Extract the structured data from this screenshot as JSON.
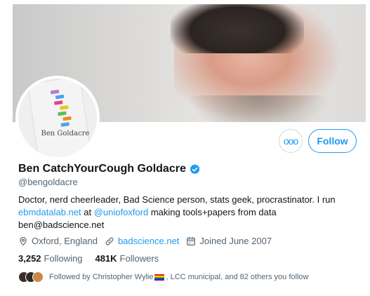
{
  "profile": {
    "name": "Ben CatchYourCough Goldacre",
    "handle": "@bengoldacre",
    "avatar_book_title": "Ben Goldacre",
    "bio": {
      "line1": "Doctor, nerd cheerleader, Bad Science person, stats geek, procrastinator. I run",
      "link1": "ebmdatalab.net",
      "at": " at ",
      "link2": "@uniofoxford",
      "line2_rest": " making tools+papers from data",
      "line3": "ben@badscience.net"
    },
    "location": "Oxford, England",
    "website": "badscience.net",
    "joined": "Joined June 2007",
    "following_count": "3,252",
    "following_label": "Following",
    "followers_count": "481K",
    "followers_label": "Followers",
    "followed_by_prefix": "Followed by Christopher Wylie",
    "followed_by_rest": ", LCC municipal, and 82 others you follow"
  },
  "actions": {
    "more_label": "ooo",
    "follow_label": "Follow"
  },
  "colors": {
    "accent": "#1d9bf0",
    "text": "#0f1419",
    "muted": "#536471"
  },
  "icons": {
    "verified": "verified-badge-icon",
    "location": "location-pin-icon",
    "link": "link-icon",
    "calendar": "calendar-icon",
    "more": "more-dots-icon"
  }
}
